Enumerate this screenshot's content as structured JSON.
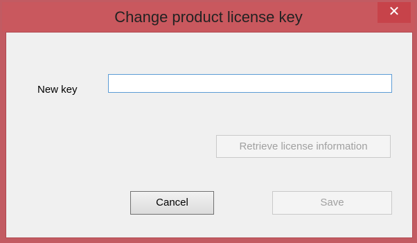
{
  "window": {
    "title": "Change product license key",
    "close_glyph": "✕",
    "accent_color": "#c9585e"
  },
  "form": {
    "new_key_label": "New key",
    "new_key_value": "",
    "new_key_placeholder": ""
  },
  "buttons": {
    "retrieve_label": "Retrieve license information",
    "cancel_label": "Cancel",
    "save_label": "Save"
  }
}
